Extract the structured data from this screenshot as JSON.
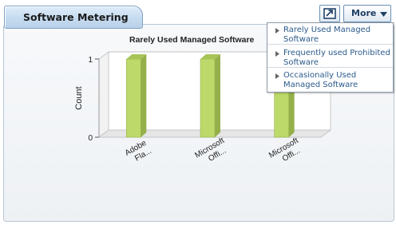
{
  "widget": {
    "title": "Software Metering",
    "more_label": "More",
    "expand_icon": "expand-icon",
    "more_arrow_icon": "triangle-down-icon"
  },
  "menu": {
    "items": [
      {
        "label": "Rarely Used Managed Software"
      },
      {
        "label": "Frequently used Prohibited Software"
      },
      {
        "label": "Occasionally Used Managed Software"
      }
    ],
    "arrow_icon": "triangle-right-icon"
  },
  "chart_data": {
    "type": "bar",
    "title": "Rarely Used Managed Software",
    "categories": [
      "Adobe Fla...",
      "Microsoft Offi...",
      "Microsoft Offi..."
    ],
    "category_lines": [
      [
        "Adobe",
        "Fla..."
      ],
      [
        "Microsoft",
        "Offi..."
      ],
      [
        "Microsoft",
        "Offi..."
      ]
    ],
    "values": [
      1,
      1,
      1
    ],
    "ylabel": "Count",
    "xlabel": "",
    "ylim": [
      0,
      1
    ],
    "yticks": [
      0,
      1
    ],
    "bar_color": "#bcd96a",
    "bar_side_color": "#95b04a",
    "bar_top_color": "#a7c456",
    "grid": false,
    "legend": "none"
  }
}
